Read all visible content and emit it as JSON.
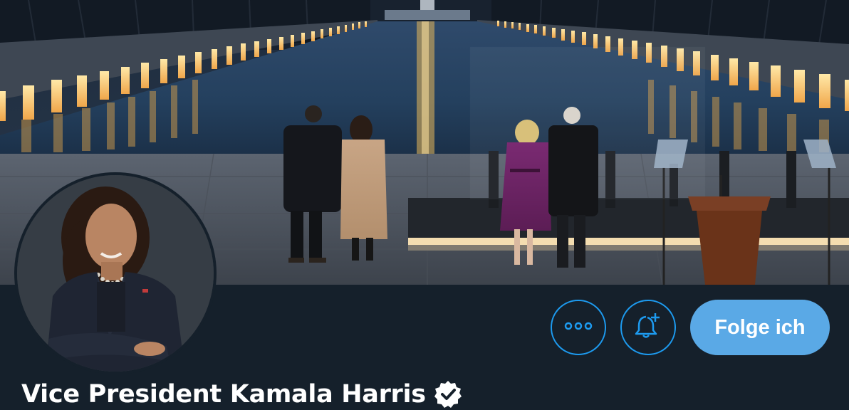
{
  "profile": {
    "display_name": "Vice President Kamala Harris",
    "verified": true
  },
  "actions": {
    "more_icon": "more-horizontal-icon",
    "notify_icon": "bell-plus-icon",
    "follow_label": "Folge ich"
  },
  "colors": {
    "background": "#15202b",
    "accent": "#1d9bf0",
    "follow_button": "#5aa9e6",
    "text": "#ffffff"
  }
}
